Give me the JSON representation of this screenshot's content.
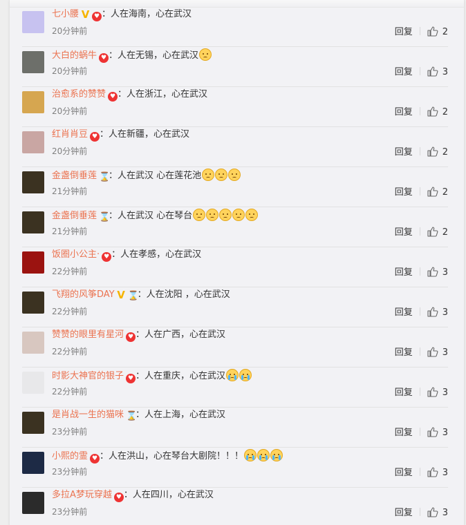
{
  "comments": [
    {
      "user": "七小腰",
      "badges": [
        "v",
        "heart"
      ],
      "text": "：人在海南，心在武汉",
      "emojis": [],
      "time": "20分钟前",
      "reply": "回复",
      "likes": "2",
      "avatar": "#c7c2f0"
    },
    {
      "user": "大白的蜗牛",
      "badges": [
        "heart"
      ],
      "text": "：人在无锡，心在武汉",
      "emojis": [
        "sad"
      ],
      "time": "20分钟前",
      "reply": "回复",
      "likes": "3",
      "avatar": "#6d6f6a"
    },
    {
      "user": "治愈系的赞赞",
      "badges": [
        "heart"
      ],
      "text": "：人在浙江，心在武汉",
      "emojis": [],
      "time": "20分钟前",
      "reply": "回复",
      "likes": "2",
      "avatar": "#d6a650"
    },
    {
      "user": "红肖肖豆",
      "badges": [
        "heart"
      ],
      "text": "：人在新疆，心在武汉",
      "emojis": [],
      "time": "20分钟前",
      "reply": "回复",
      "likes": "2",
      "avatar": "#c9a6a3"
    },
    {
      "user": "金盏倒垂莲",
      "badges": [
        "hour"
      ],
      "text": "：人在武汉 心在莲花池",
      "emojis": [
        "sad",
        "sad",
        "sad"
      ],
      "time": "21分钟前",
      "reply": "回复",
      "likes": "2",
      "avatar": "#3b3221"
    },
    {
      "user": "金盏倒垂莲",
      "badges": [
        "hour"
      ],
      "text": "：人在武汉 心在琴台",
      "emojis": [
        "sad",
        "sad",
        "sad",
        "sad",
        "sad"
      ],
      "time": "21分钟前",
      "reply": "回复",
      "likes": "2",
      "avatar": "#3b3221"
    },
    {
      "user": "饭圈小公主·",
      "badges": [
        "heart"
      ],
      "text": "：人在孝感，心在武汉",
      "emojis": [],
      "time": "22分钟前",
      "reply": "回复",
      "likes": "3",
      "avatar": "#9b1310"
    },
    {
      "user": "飞翔的风筝DAY",
      "badges": [
        "v",
        "hour"
      ],
      "text": "：人在沈阳 ，心在武汉",
      "emojis": [],
      "time": "22分钟前",
      "reply": "回复",
      "likes": "3",
      "avatar": "#3b3221"
    },
    {
      "user": "赞赞的眼里有星河",
      "badges": [
        "heart"
      ],
      "text": "：人在广西，心在武汉",
      "emojis": [],
      "time": "22分钟前",
      "reply": "回复",
      "likes": "3",
      "avatar": "#d8c7c0"
    },
    {
      "user": "时影大神官的银子",
      "badges": [
        "heart"
      ],
      "text": "：人在重庆，心在武汉",
      "emojis": [
        "cry",
        "cry"
      ],
      "time": "22分钟前",
      "reply": "回复",
      "likes": "3",
      "avatar": "#e8e8ea"
    },
    {
      "user": "是肖战一生的猫咪",
      "badges": [
        "hour"
      ],
      "text": "：人在上海，心在武汉",
      "emojis": [],
      "time": "23分钟前",
      "reply": "回复",
      "likes": "3",
      "avatar": "#3b3221"
    },
    {
      "user": "小熙的霊",
      "badges": [
        "heart"
      ],
      "text": "：人在洪山，心在琴台大剧院！！！",
      "emojis": [
        "cry",
        "cry",
        "cry"
      ],
      "time": "23分钟前",
      "reply": "回复",
      "likes": "3",
      "avatar": "#1d2a45"
    },
    {
      "user": "多拉A梦玩穿越",
      "badges": [
        "heart"
      ],
      "text": "：人在四川，心在武汉",
      "emojis": [],
      "time": "23分钟前",
      "reply": "回复",
      "likes": "3",
      "avatar": "#2b2b2b"
    }
  ]
}
